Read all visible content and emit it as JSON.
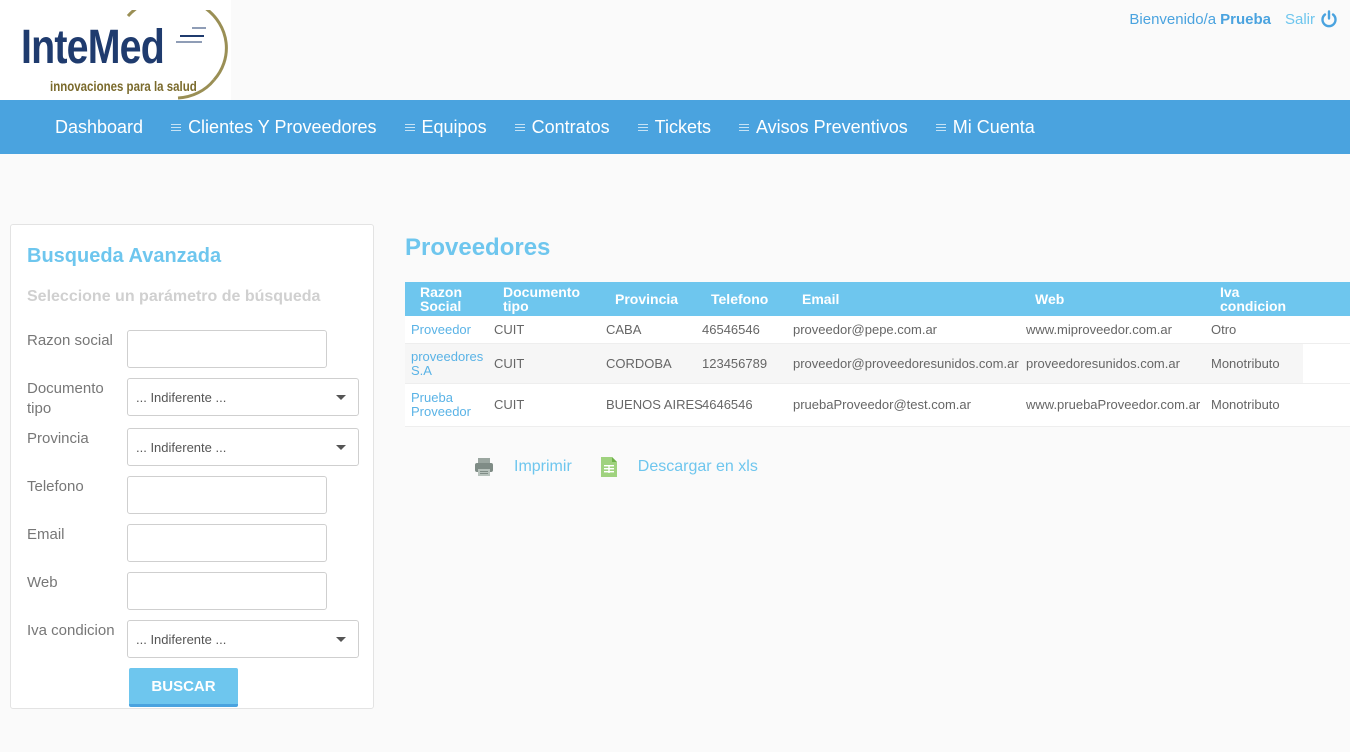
{
  "logo": {
    "name": "InteMed",
    "tagline": "innovaciones para la salud"
  },
  "user": {
    "welcome": "Bienvenido/a",
    "name": "Prueba",
    "logout": "Salir"
  },
  "nav": {
    "items": [
      {
        "label": "Dashboard"
      },
      {
        "label": "Clientes Y Proveedores"
      },
      {
        "label": "Equipos"
      },
      {
        "label": "Contratos"
      },
      {
        "label": "Tickets"
      },
      {
        "label": "Avisos Preventivos"
      },
      {
        "label": "Mi Cuenta"
      }
    ]
  },
  "sidebar": {
    "title": "Busqueda Avanzada",
    "subtitle": "Seleccione un parámetro de búsqueda",
    "fields": [
      {
        "label": "Razon social",
        "value": ""
      },
      {
        "label": "Documento tipo",
        "value": "... Indiferente ..."
      },
      {
        "label": "Provincia",
        "value": "... Indiferente ..."
      },
      {
        "label": "Telefono",
        "value": ""
      },
      {
        "label": "Email",
        "value": ""
      },
      {
        "label": "Web",
        "value": ""
      },
      {
        "label": "Iva condicion",
        "value": "... Indiferente ..."
      }
    ],
    "button": "BUSCAR"
  },
  "main": {
    "title": "Proveedores",
    "columns": [
      "Razon Social",
      "Documento tipo",
      "Provincia",
      "Telefono",
      "Email",
      "Web",
      "Iva condicion"
    ],
    "rows": [
      {
        "razon": "Proveedor",
        "doc": "CUIT",
        "provincia": "CABA",
        "telefono": "46546546",
        "email": "proveedor@pepe.com.ar",
        "web": "www.miproveedor.com.ar",
        "iva": "Otro"
      },
      {
        "razon": "proveedores S.A",
        "doc": "CUIT",
        "provincia": "CORDOBA",
        "telefono": "123456789",
        "email": "proveedor@proveedoresunidos.com.ar",
        "web": "proveedoresunidos.com.ar",
        "iva": "Monotributo"
      },
      {
        "razon": "Prueba Proveedor",
        "doc": "CUIT",
        "provincia": "BUENOS AIRES",
        "telefono": "4646546",
        "email": "pruebaProveedor@test.com.ar",
        "web": "www.pruebaProveedor.com.ar",
        "iva": "Monotributo"
      }
    ],
    "actions": {
      "print": "Imprimir",
      "download": "Descargar en xls"
    }
  },
  "colors": {
    "primary": "#4aa3df",
    "accent": "#6ec6ee",
    "logo_blue": "#1f3b6e",
    "logo_gold": "#7a6a2b"
  },
  "icons": [
    "power-icon",
    "menu-icon",
    "caret-down-icon",
    "printer-icon",
    "spreadsheet-icon"
  ]
}
